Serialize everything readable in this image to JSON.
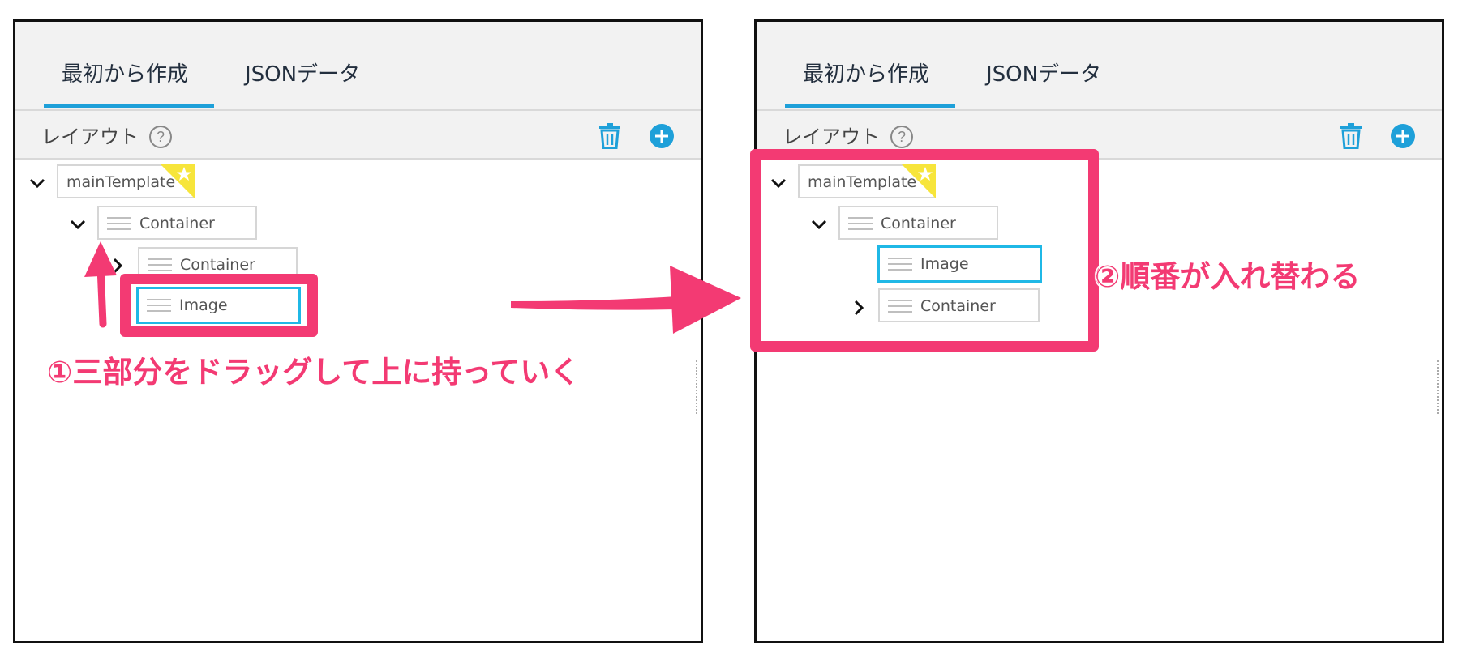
{
  "tabs": {
    "create_from_scratch": "最初から作成",
    "json_data": "JSONデータ"
  },
  "toolbar": {
    "layout_label": "レイアウト",
    "help_glyph": "?"
  },
  "icons": {
    "help": "help-icon",
    "delete": "trash-icon",
    "add": "add-circle-icon",
    "drag": "drag-handle-icon",
    "expand": "chevron-icon",
    "main": "star-icon"
  },
  "colors": {
    "accent": "#1ea0d9",
    "annotation": "#f33a73",
    "selected_border": "#1fb8e6",
    "star_badge": "#f7e53b"
  },
  "before_tree": {
    "root": "mainTemplate",
    "container": "Container",
    "child_container": "Container",
    "image": "Image"
  },
  "after_tree": {
    "root": "mainTemplate",
    "container": "Container",
    "image": "Image",
    "child_container": "Container"
  },
  "annotations": {
    "step1": "①三部分をドラッグして上に持っていく",
    "step2": "②順番が入れ替わる"
  }
}
